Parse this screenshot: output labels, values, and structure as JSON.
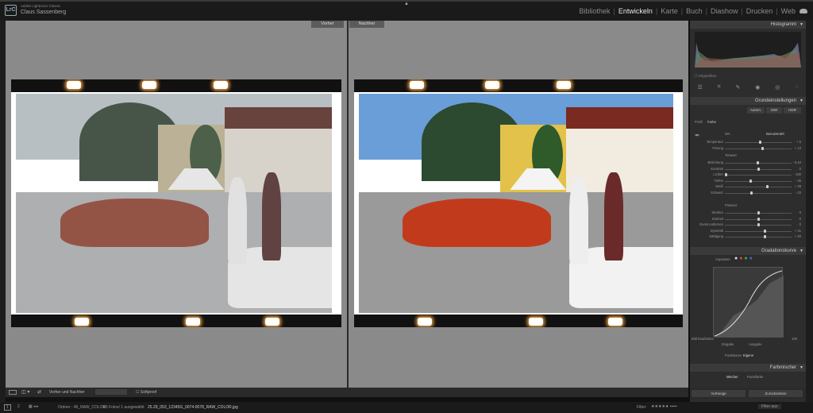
{
  "app": {
    "name": "Adobe Lightroom Classic",
    "user": "Claus Sassenberg",
    "logo": "LrC"
  },
  "modules": [
    "Bibliothek",
    "Entwickeln",
    "Karte",
    "Buch",
    "Diashow",
    "Drucken",
    "Web"
  ],
  "active_module": "Entwickeln",
  "view": {
    "before_label": "Vorher",
    "after_label": "Nachher"
  },
  "right_panel": {
    "histogram_title": "Histogramm",
    "original_photo": "Originalfoto",
    "basic_title": "Grundeinstellungen",
    "auto_btn": "Autom.",
    "sw_btn": "S/W",
    "hdr_btn": "HDR",
    "profile_label": "Profil",
    "profile_value": "Farbe",
    "wb_label": "WA",
    "wb_value": "Benutzerdef.",
    "sliders_wb": [
      {
        "label": "Temperatur",
        "value": "+ 5",
        "pos": 0.52
      },
      {
        "label": "Tönung",
        "value": "+ 14",
        "pos": 0.56
      }
    ],
    "tone_label": "Tonwert",
    "sliders_tone": [
      {
        "label": "Belichtung",
        "value": "- 0,10",
        "pos": 0.49
      },
      {
        "label": "Kontrast",
        "value": "0",
        "pos": 0.5
      },
      {
        "label": "Lichter",
        "value": "- 100",
        "pos": 0.0
      },
      {
        "label": "Tiefen",
        "value": "- 25",
        "pos": 0.38
      },
      {
        "label": "Weiß",
        "value": "+ 29",
        "pos": 0.64
      },
      {
        "label": "Schwarz",
        "value": "- 23",
        "pos": 0.39
      }
    ],
    "presence_label": "Präsenz",
    "sliders_presence": [
      {
        "label": "Struktur",
        "value": "0",
        "pos": 0.5
      },
      {
        "label": "Klarheit",
        "value": "0",
        "pos": 0.5
      },
      {
        "label": "Dunst entfernen",
        "value": "0",
        "pos": 0.5
      },
      {
        "label": "Dynamik",
        "value": "+ 21",
        "pos": 0.6
      },
      {
        "label": "Sättigung",
        "value": "+ 20",
        "pos": 0.6
      }
    ],
    "curve_title": "Gradationskurve",
    "curve_adjust": "Anpassen",
    "curve_edit": "Bild bearbeiten",
    "curve_input": "Eingabe",
    "curve_output": "Ausgabe",
    "curve_value": "100",
    "point_curve_label": "Punktkurve",
    "point_curve_value": "Eigene",
    "mixer_title": "Farbmischer",
    "mixer_tabs": [
      "Mischer",
      "Punktfarbe"
    ],
    "prev_btn": "Vorherige",
    "reset_btn": "Zurücksetzen"
  },
  "bottom_toolbar": {
    "compare_label": "Vorher und Nachher",
    "softproof": "Softproof"
  },
  "status": {
    "pages": [
      "1",
      "2"
    ],
    "path": "Ordner : 46_RAW_COLOR",
    "count": "80 Fotos/ 1 ausgewählt",
    "filename": "25.29_053_12345G_0074-0078_RAW_COLOR.jpg",
    "filter_label": "Filter:",
    "filter_value": "Filter aus"
  },
  "colors": {
    "accent": "#e8e8e8",
    "panel": "#2d2d2d",
    "canvas": "#8a8a8a"
  },
  "icons": [
    "cloud-icon",
    "histogram",
    "crop-icon",
    "heal-icon",
    "mask-icon",
    "redeye-icon",
    "eyedropper-icon"
  ]
}
